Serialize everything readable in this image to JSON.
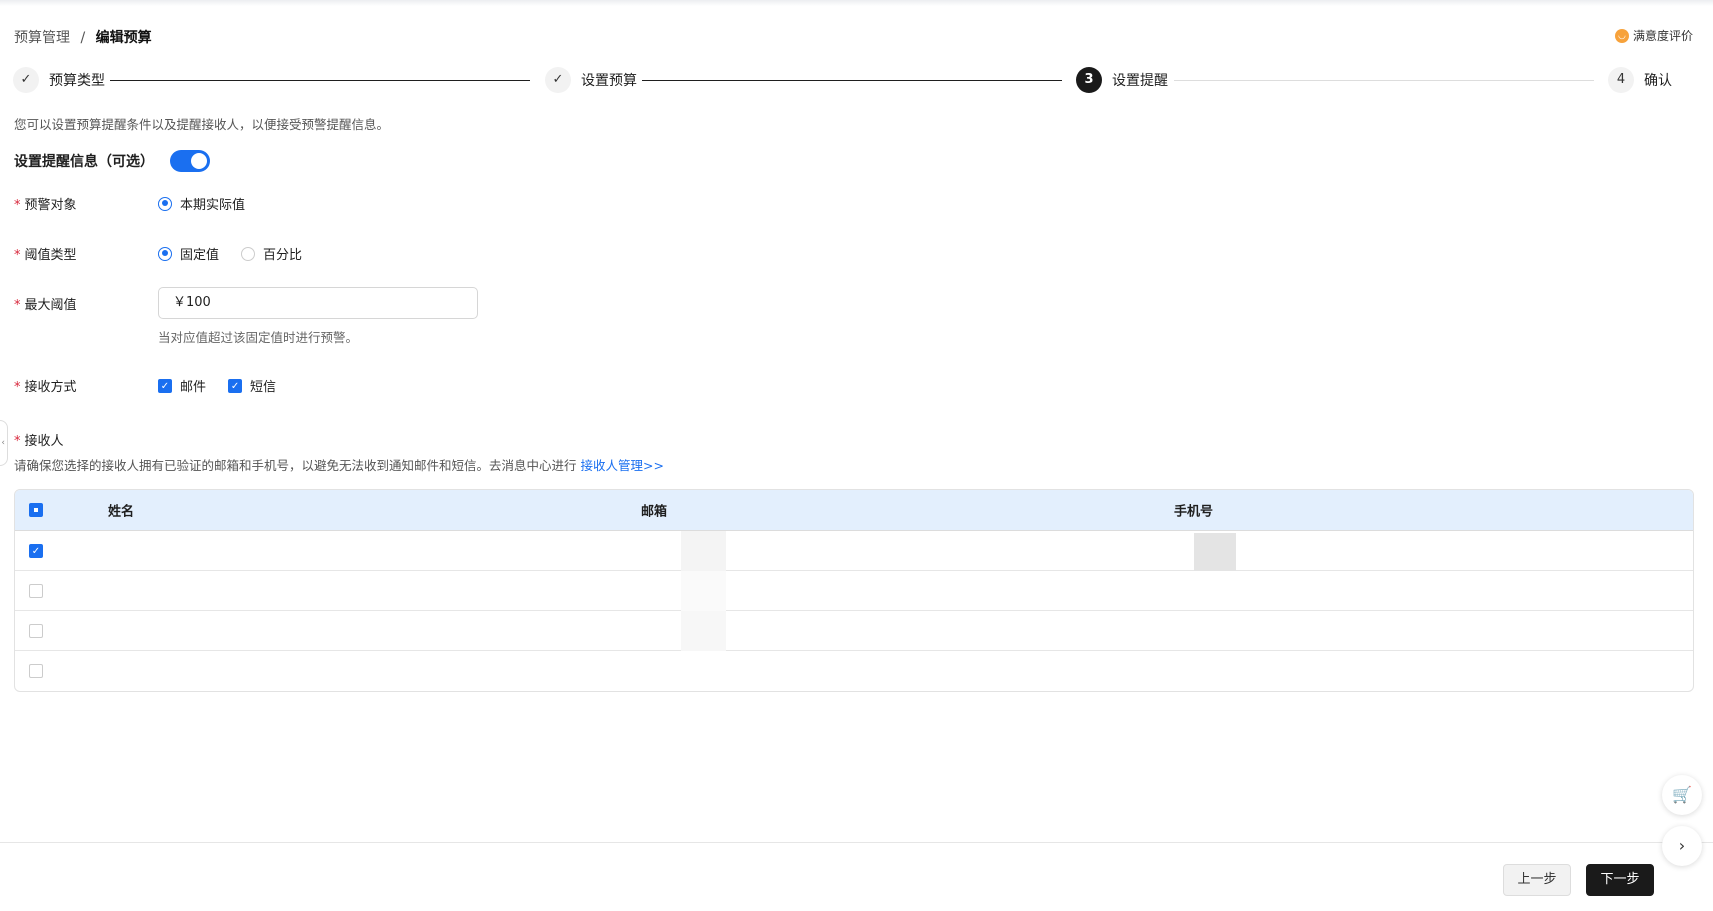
{
  "breadcrumb": {
    "parent": "预算管理",
    "separator": "/",
    "current": "编辑预算"
  },
  "satisfaction": {
    "label": "满意度评价"
  },
  "steps": [
    {
      "index": "✓",
      "label": "预算类型",
      "status": "done"
    },
    {
      "index": "✓",
      "label": "设置预算",
      "status": "done"
    },
    {
      "index": "3",
      "label": "设置提醒",
      "status": "active"
    },
    {
      "index": "4",
      "label": "确认",
      "status": "pending"
    }
  ],
  "description": "您可以设置预算提醒条件以及提醒接收人，以便接受预警提醒信息。",
  "section": {
    "title": "设置提醒信息（可选）",
    "enabled": true
  },
  "form": {
    "required_mark": "*",
    "target": {
      "label": "预警对象",
      "option": "本期实际值"
    },
    "threshold_type": {
      "label": "阈值类型",
      "options": [
        "固定值",
        "百分比"
      ],
      "selected": "固定值"
    },
    "max_threshold": {
      "label": "最大阈值",
      "value": "￥100",
      "hint": "当对应值超过该固定值时进行预警。"
    },
    "receive_method": {
      "label": "接收方式",
      "options": [
        "邮件",
        "短信"
      ]
    },
    "receivers": {
      "label": "接收人",
      "note": "请确保您选择的接收人拥有已验证的邮箱和手机号，以避免无法收到通知邮件和短信。去消息中心进行",
      "link": "接收人管理>>"
    }
  },
  "table": {
    "columns": [
      "姓名",
      "邮箱",
      "手机号"
    ],
    "rows": [
      {
        "checked": true
      },
      {
        "checked": false
      },
      {
        "checked": false
      },
      {
        "checked": false
      }
    ]
  },
  "footer": {
    "prev": "上一步",
    "next": "下一步"
  },
  "colors": {
    "primary": "#1a6ff0",
    "header_bg": "#e3effd",
    "dark": "#1a1a1a"
  }
}
